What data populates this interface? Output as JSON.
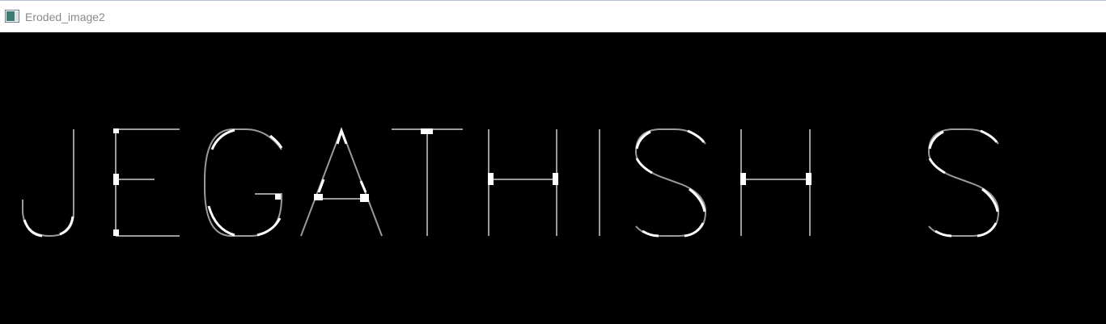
{
  "window": {
    "title": "Eroded_image2",
    "icon": "image-window-icon"
  },
  "canvas": {
    "background": "#000000",
    "glyph_color": "#ffffff",
    "stroke_color": "#9a9a9a"
  }
}
